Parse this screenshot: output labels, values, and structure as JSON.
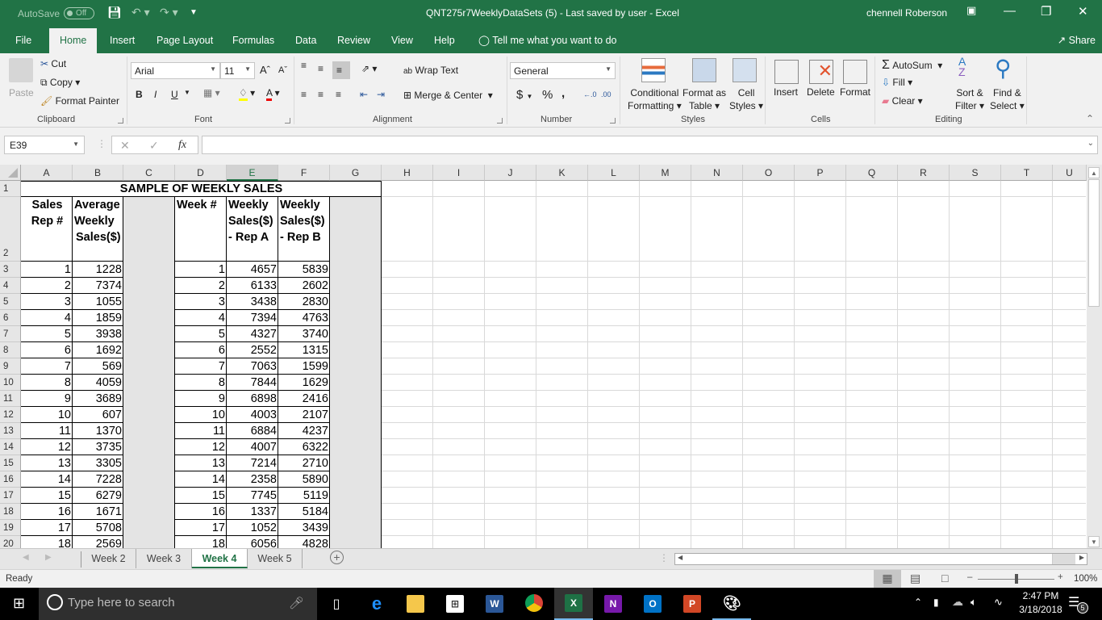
{
  "titlebar": {
    "autosave_label": "AutoSave",
    "autosave_state": "Off",
    "title": "QNT275r7WeeklyDataSets (5)  -  Last saved by user  -  Excel",
    "user": "chennell Roberson"
  },
  "menu": {
    "tabs": [
      "File",
      "Home",
      "Insert",
      "Page Layout",
      "Formulas",
      "Data",
      "Review",
      "View",
      "Help"
    ],
    "active": "Home",
    "tell_me": "Tell me what you want to do",
    "share": "Share"
  },
  "ribbon": {
    "clipboard": {
      "label": "Clipboard",
      "paste": "Paste",
      "cut": "Cut",
      "copy": "Copy",
      "format_painter": "Format Painter"
    },
    "font": {
      "label": "Font",
      "font_name": "Arial",
      "font_size": "11",
      "bold": "B",
      "italic": "I",
      "underline": "U"
    },
    "alignment": {
      "label": "Alignment",
      "wrap_text": "Wrap Text",
      "merge_center": "Merge & Center"
    },
    "number": {
      "label": "Number",
      "format": "General",
      "currency": "$",
      "percent": "%",
      "comma": ","
    },
    "styles": {
      "label": "Styles",
      "conditional_1": "Conditional",
      "conditional_2": "Formatting",
      "format_table_1": "Format as",
      "format_table_2": "Table",
      "cell_styles_1": "Cell",
      "cell_styles_2": "Styles"
    },
    "cells": {
      "label": "Cells",
      "insert": "Insert",
      "delete": "Delete",
      "format": "Format"
    },
    "editing": {
      "label": "Editing",
      "autosum": "AutoSum",
      "fill": "Fill",
      "clear": "Clear",
      "sort_1": "Sort &",
      "sort_2": "Filter",
      "find_1": "Find &",
      "find_2": "Select"
    }
  },
  "formula_bar": {
    "name_box": "E39",
    "fx": "fx",
    "formula": ""
  },
  "columns": [
    "A",
    "B",
    "C",
    "D",
    "E",
    "F",
    "G",
    "H",
    "I",
    "J",
    "K",
    "L",
    "M",
    "N",
    "O",
    "P",
    "Q",
    "R",
    "S",
    "T",
    "U"
  ],
  "selected_column": "E",
  "sheet": {
    "title": "SAMPLE OF WEEKLY SALES",
    "headers": {
      "a": [
        "Sales",
        "Rep  #"
      ],
      "b": [
        "Average",
        "Weekly",
        "Sales($)"
      ],
      "d": [
        "Week #"
      ],
      "e": [
        "Weekly",
        "Sales($)",
        "- Rep A"
      ],
      "f": [
        "Weekly",
        "Sales($)",
        "- Rep B"
      ]
    },
    "rows": [
      {
        "row": 3,
        "rep": 1,
        "avg": 1228,
        "week": 1,
        "rep_a": 4657,
        "rep_b": 5839
      },
      {
        "row": 4,
        "rep": 2,
        "avg": 7374,
        "week": 2,
        "rep_a": 6133,
        "rep_b": 2602
      },
      {
        "row": 5,
        "rep": 3,
        "avg": 1055,
        "week": 3,
        "rep_a": 3438,
        "rep_b": 2830
      },
      {
        "row": 6,
        "rep": 4,
        "avg": 1859,
        "week": 4,
        "rep_a": 7394,
        "rep_b": 4763
      },
      {
        "row": 7,
        "rep": 5,
        "avg": 3938,
        "week": 5,
        "rep_a": 4327,
        "rep_b": 3740
      },
      {
        "row": 8,
        "rep": 6,
        "avg": 1692,
        "week": 6,
        "rep_a": 2552,
        "rep_b": 1315
      },
      {
        "row": 9,
        "rep": 7,
        "avg": 569,
        "week": 7,
        "rep_a": 7063,
        "rep_b": 1599
      },
      {
        "row": 10,
        "rep": 8,
        "avg": 4059,
        "week": 8,
        "rep_a": 7844,
        "rep_b": 1629
      },
      {
        "row": 11,
        "rep": 9,
        "avg": 3689,
        "week": 9,
        "rep_a": 6898,
        "rep_b": 2416
      },
      {
        "row": 12,
        "rep": 10,
        "avg": 607,
        "week": 10,
        "rep_a": 4003,
        "rep_b": 2107
      },
      {
        "row": 13,
        "rep": 11,
        "avg": 1370,
        "week": 11,
        "rep_a": 6884,
        "rep_b": 4237
      },
      {
        "row": 14,
        "rep": 12,
        "avg": 3735,
        "week": 12,
        "rep_a": 4007,
        "rep_b": 6322
      },
      {
        "row": 15,
        "rep": 13,
        "avg": 3305,
        "week": 13,
        "rep_a": 7214,
        "rep_b": 2710
      },
      {
        "row": 16,
        "rep": 14,
        "avg": 7228,
        "week": 14,
        "rep_a": 2358,
        "rep_b": 5890
      },
      {
        "row": 17,
        "rep": 15,
        "avg": 6279,
        "week": 15,
        "rep_a": 7745,
        "rep_b": 5119
      },
      {
        "row": 18,
        "rep": 16,
        "avg": 1671,
        "week": 16,
        "rep_a": 1337,
        "rep_b": 5184
      },
      {
        "row": 19,
        "rep": 17,
        "avg": 5708,
        "week": 17,
        "rep_a": 1052,
        "rep_b": 3439
      },
      {
        "row": 20,
        "rep": 18,
        "avg": 2569,
        "week": 18,
        "rep_a": 6056,
        "rep_b": 4828
      }
    ]
  },
  "sheet_tabs": [
    "Week 2",
    "Week 3",
    "Week 4",
    "Week 5"
  ],
  "active_sheet": "Week 4",
  "status": {
    "text": "Ready",
    "zoom": "100%",
    "zoom_percent": 100
  },
  "taskbar": {
    "search_placeholder": "Type here to search",
    "time": "2:47 PM",
    "date": "3/18/2018",
    "notifications": "5",
    "apps": [
      "task-view",
      "edge",
      "file-explorer",
      "store",
      "word",
      "chrome",
      "excel",
      "onenote",
      "outlook",
      "powerpoint",
      "paint"
    ]
  },
  "colors": {
    "excel_green": "#217346",
    "ribbon_bg": "#f1f1f1",
    "shade": "#e4e4e4"
  }
}
